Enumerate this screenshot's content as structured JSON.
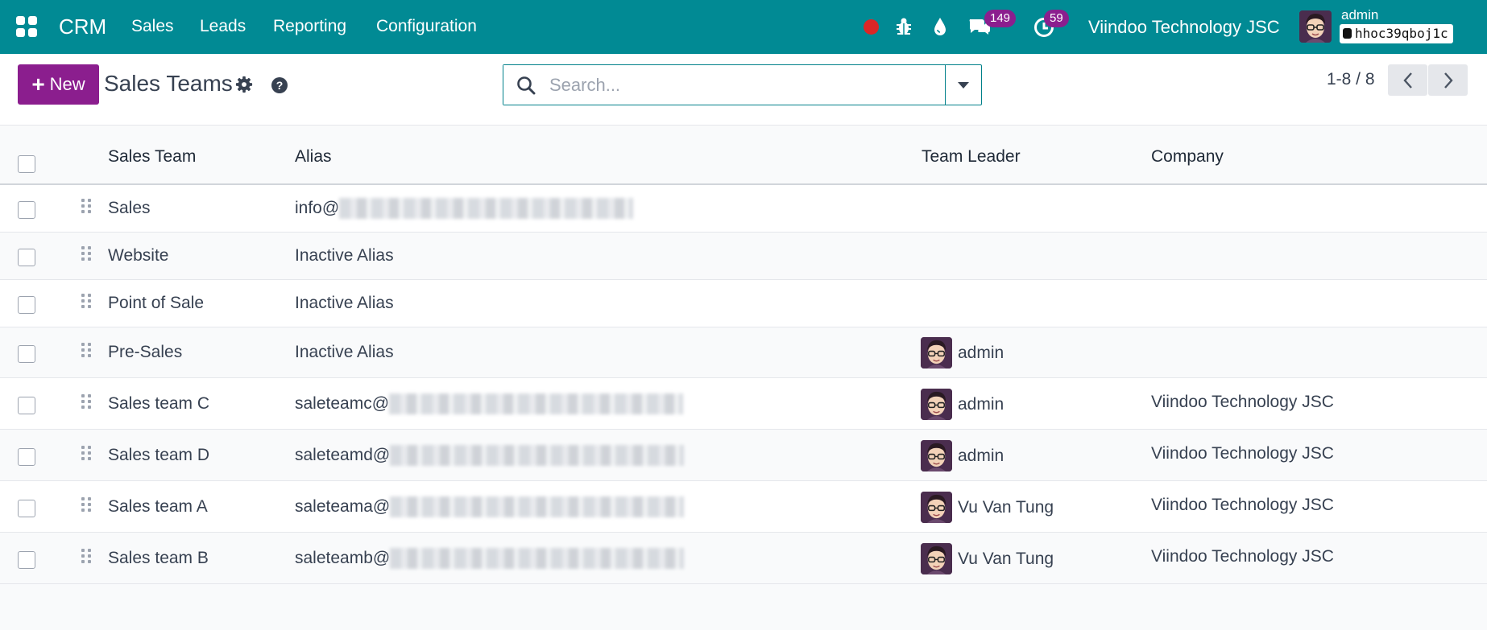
{
  "navbar": {
    "brand": "CRM",
    "menu": [
      "Sales",
      "Leads",
      "Reporting",
      "Configuration"
    ],
    "messages_count": "149",
    "activities_count": "59",
    "company": "Viindoo Technology JSC",
    "user": "admin",
    "database": "hhoc39qboj1c"
  },
  "control": {
    "new_label": "New",
    "title": "Sales Teams",
    "search_placeholder": "Search...",
    "pager": "1-8 / 8"
  },
  "table": {
    "headers": [
      "Sales Team",
      "Alias",
      "Team Leader",
      "Company"
    ],
    "rows": [
      {
        "team": "Sales",
        "alias": "info@",
        "alias_blurred": true,
        "leader": "",
        "company": ""
      },
      {
        "team": "Website",
        "alias": "Inactive Alias",
        "alias_blurred": false,
        "leader": "",
        "company": ""
      },
      {
        "team": "Point of Sale",
        "alias": "Inactive Alias",
        "alias_blurred": false,
        "leader": "",
        "company": ""
      },
      {
        "team": "Pre-Sales",
        "alias": "Inactive Alias",
        "alias_blurred": false,
        "leader": "admin",
        "company": ""
      },
      {
        "team": "Sales team C",
        "alias": "saleteamc@",
        "alias_blurred": true,
        "leader": "admin",
        "company": "Viindoo Technology JSC"
      },
      {
        "team": "Sales team D",
        "alias": "saleteamd@",
        "alias_blurred": true,
        "leader": "admin",
        "company": "Viindoo Technology JSC"
      },
      {
        "team": "Sales team A",
        "alias": "saleteama@",
        "alias_blurred": true,
        "leader": "Vu Van Tung",
        "company": "Viindoo Technology JSC"
      },
      {
        "team": "Sales team B",
        "alias": "saleteamb@",
        "alias_blurred": true,
        "leader": "Vu Van Tung",
        "company": "Viindoo Technology JSC"
      }
    ]
  },
  "colors": {
    "navbar": "#018a94",
    "primary_button": "#8b1e8e",
    "badge": "#8b1e8e",
    "record": "#dc2626"
  },
  "icons": [
    "apps-grid-icon",
    "record-icon",
    "bug-icon",
    "drop-icon",
    "chat-icon",
    "clock-icon",
    "gear-icon",
    "help-icon",
    "search-icon",
    "chevron-left-icon",
    "chevron-right-icon",
    "drag-handle-icon"
  ]
}
